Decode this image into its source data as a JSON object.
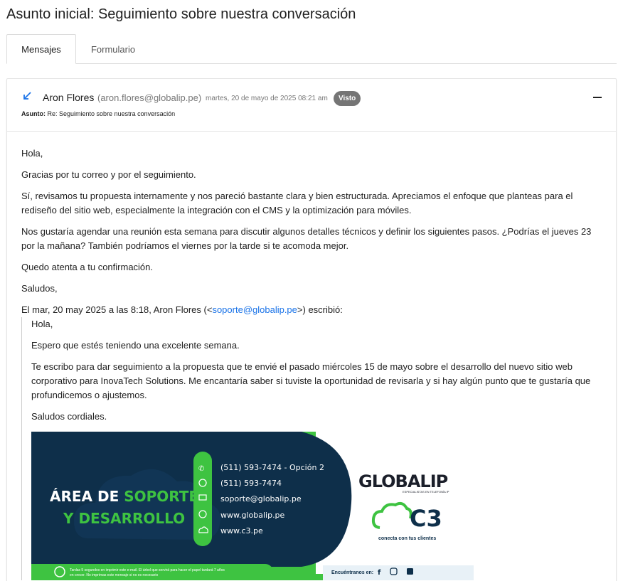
{
  "page": {
    "title": "Asunto inicial: Seguimiento sobre nuestra conversación"
  },
  "tabs": [
    {
      "label": "Mensajes"
    },
    {
      "label": "Formulario"
    }
  ],
  "message": {
    "sender_name": "Aron Flores",
    "sender_email": "(aron.flores@globalip.pe)",
    "date": "martes, 20 de mayo de 2025 08:21 am",
    "badge": "Visto",
    "subject_label": "Asunto:",
    "subject": "Re: Seguimiento sobre nuestra conversación",
    "direction_icon": "arrow-down-left-icon",
    "collapse_icon": "minus-icon"
  },
  "reply": {
    "greeting": "Hola,",
    "p1": "Gracias por tu correo y por el seguimiento.",
    "p2": "Sí, revisamos tu propuesta internamente y nos pareció bastante clara y bien estructurada. Apreciamos el enfoque que planteas para el rediseño del sitio web, especialmente la integración con el CMS y la optimización para móviles.",
    "p3": "Nos gustaría agendar una reunión esta semana para discutir algunos detalles técnicos y definir los siguientes pasos. ¿Podrías el jueves 23 por la mañana? También podríamos el viernes por la tarde si te acomoda mejor.",
    "p4": "Quedo atenta a tu confirmación.",
    "closing": "Saludos,",
    "quote_intro_pre": "El mar, 20 may 2025 a las 8:18, Aron Flores (<",
    "quote_intro_link": "soporte@globalip.pe",
    "quote_intro_post": ">) escribió:"
  },
  "quoted": {
    "greeting": "Hola,",
    "p1": "Espero que estés teniendo una excelente semana.",
    "p2": "Te escribo para dar seguimiento a la propuesta que te envié el pasado miércoles 15 de mayo sobre el desarrollo del nuevo sitio web corporativo para InovaTech Solutions. Me encantaría saber si tuviste la oportunidad de revisarla y si hay algún punto que te gustaría que profundicemos o ajustemos.",
    "closing": "Saludos cordiales."
  },
  "signature": {
    "title_part1": "ÁREA DE ",
    "title_part2": "SOPORTE",
    "title_line2": "Y DESARROLLO",
    "phone1": "(511) 593-7474 - Opción 2",
    "phone2": "(511) 593-7474",
    "email": "soporte@globalip.pe",
    "web1": "www.globalip.pe",
    "web2": "www.c3.pe",
    "brand": "GLOBALIP",
    "brand_tagline": "ESPECIALISTAS EN TELEFONÍA IP",
    "c3_brand": "C3",
    "c3_tagline": "conecta con tus clientes",
    "eco_note_line1": "Tardas 5 segundos en imprimir este e-mail. El árbol que servirá para hacer el papel tardará 7 años",
    "eco_note_line2": "en crecer. No imprimas este mensaje si no es necesario",
    "social_label": "Encuéntranos en:",
    "colors": {
      "navy": "#0e2f4a",
      "green": "#3ec341",
      "dark": "#1b1f2a"
    }
  }
}
